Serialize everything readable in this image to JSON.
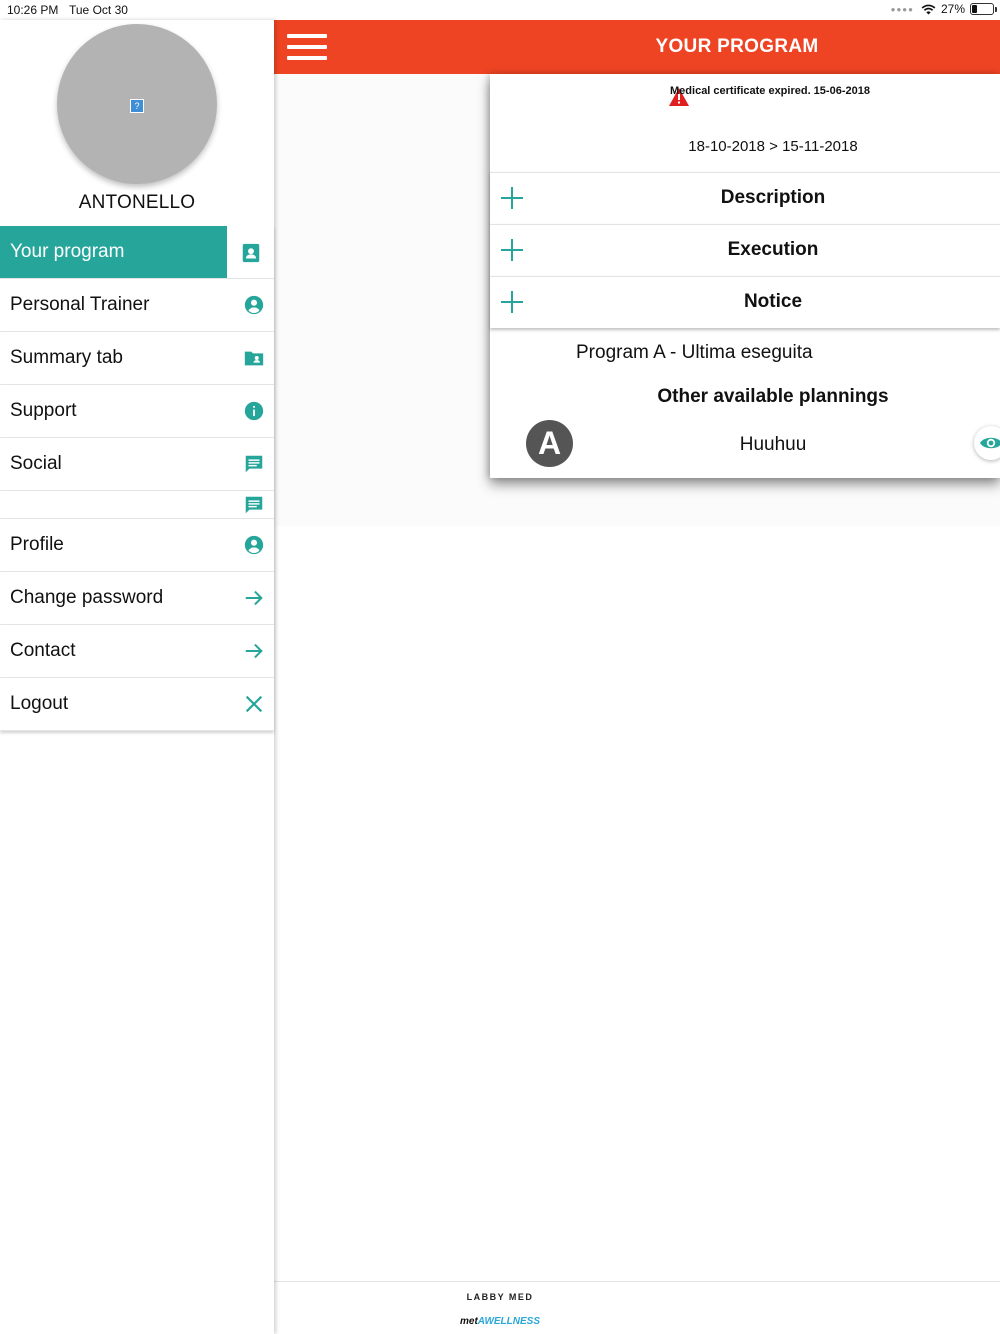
{
  "status_bar": {
    "time": "10:26 PM",
    "date": "Tue Oct 30",
    "battery": "27%",
    "battery_level": 0.27
  },
  "sidebar": {
    "user_name": "ANTONELLO",
    "items": [
      {
        "label": "Your program",
        "icon": "contact-card-icon",
        "active": true
      },
      {
        "label": "Personal Trainer",
        "icon": "account-circle-icon"
      },
      {
        "label": "Summary tab",
        "icon": "folder-account-icon"
      },
      {
        "label": "Support",
        "icon": "info-icon"
      },
      {
        "label": "Social",
        "icon": "chat-icon"
      },
      {
        "label": "",
        "icon": "chat-icon"
      },
      {
        "label": "Profile",
        "icon": "account-circle-icon"
      },
      {
        "label": "Change password",
        "icon": "arrow-right-icon"
      },
      {
        "label": "Contact",
        "icon": "arrow-right-icon"
      },
      {
        "label": "Logout",
        "icon": "close-icon"
      }
    ]
  },
  "header": {
    "title": "YOUR PROGRAM"
  },
  "program": {
    "warning": "Medical certificate expired. 15-06-2018",
    "date_range": "18-10-2018 > 15-11-2018",
    "sections": [
      "Description",
      "Execution",
      "Notice"
    ],
    "current_program": "Program A - Ultima eseguita",
    "other_title": "Other available plannings",
    "plannings": [
      {
        "badge": "A",
        "name": "Huuhuu"
      }
    ]
  },
  "footer": {
    "brand_line1": "LABBY MED",
    "brand_line2_prefix": "met",
    "brand_line2_accent": "AWELLNESS"
  },
  "colors": {
    "accent": "#26a69a",
    "header": "#ee4424",
    "warning": "#e02020"
  }
}
